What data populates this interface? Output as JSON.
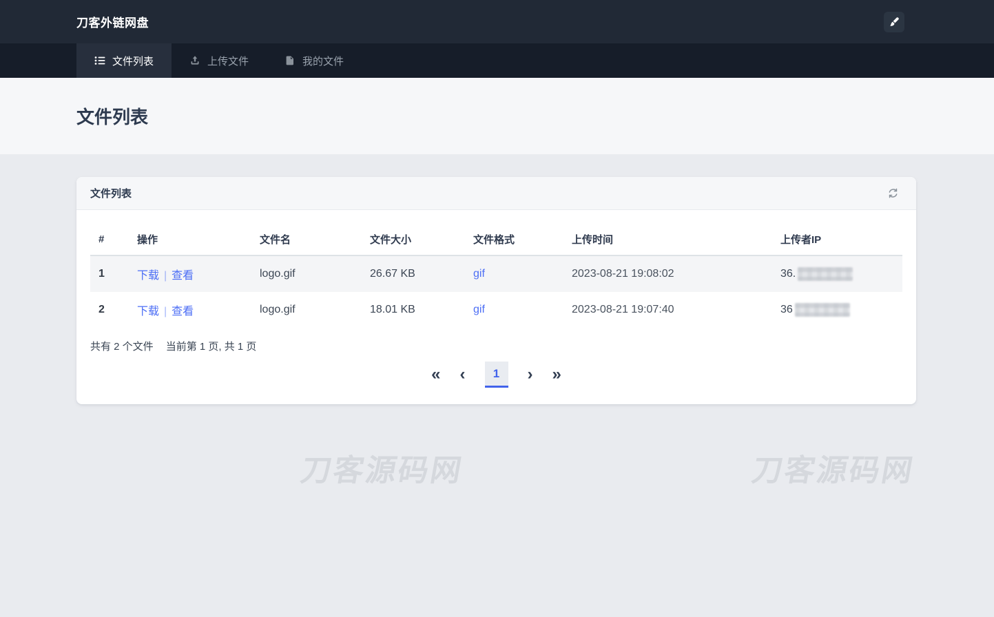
{
  "app": {
    "brand": "刀客外链网盘"
  },
  "header": {
    "theme_button_icon": "paintbrush-icon"
  },
  "nav": {
    "tabs": [
      {
        "label": "文件列表",
        "icon": "list-icon",
        "active": true
      },
      {
        "label": "上传文件",
        "icon": "upload-icon",
        "active": false
      },
      {
        "label": "我的文件",
        "icon": "file-icon",
        "active": false
      }
    ]
  },
  "page": {
    "title": "文件列表"
  },
  "card": {
    "title": "文件列表",
    "refresh_icon": "refresh-icon"
  },
  "table": {
    "headers": [
      "#",
      "操作",
      "文件名",
      "文件大小",
      "文件格式",
      "上传时间",
      "上传者IP"
    ],
    "action_separator": "|",
    "rows": [
      {
        "index": "1",
        "actions": [
          "下载",
          "查看"
        ],
        "filename": "logo.gif",
        "size": "26.67 KB",
        "format": "gif",
        "uploaded": "2023-08-21 19:08:02",
        "ip_visible": "36.",
        "ip_redacted": true
      },
      {
        "index": "2",
        "actions": [
          "下载",
          "查看"
        ],
        "filename": "logo.gif",
        "size": "18.01 KB",
        "format": "gif",
        "uploaded": "2023-08-21 19:07:40",
        "ip_visible": "36",
        "ip_redacted": true
      }
    ]
  },
  "summary": {
    "total": "共有 2 个文件",
    "page_info": "当前第 1 页, 共 1 页"
  },
  "pagination": {
    "first": "«",
    "prev": "‹",
    "current": "1",
    "next": "›",
    "last": "»"
  },
  "watermark": {
    "text": "刀客源码网"
  },
  "colors": {
    "accent_link": "#4c6ef5",
    "pagination_active": "#4263eb",
    "header_bg": "#212936",
    "nav_bg": "#161d29"
  }
}
